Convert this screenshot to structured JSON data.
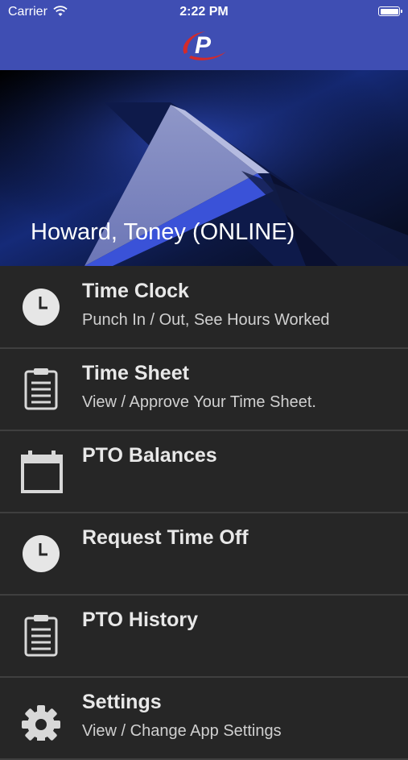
{
  "status_bar": {
    "carrier": "Carrier",
    "time": "2:22 PM"
  },
  "header": {
    "logo_icon": "company-p-logo"
  },
  "hero": {
    "user_label": "Howard, Toney (ONLINE)"
  },
  "menu": {
    "items": [
      {
        "title": "Time Clock",
        "subtitle": "Punch In / Out, See Hours Worked",
        "icon": "clock-icon"
      },
      {
        "title": "Time Sheet",
        "subtitle": "View / Approve Your Time Sheet.",
        "icon": "clipboard-icon"
      },
      {
        "title": "PTO Balances",
        "subtitle": "",
        "icon": "calendar-icon"
      },
      {
        "title": "Request Time Off",
        "subtitle": "",
        "icon": "clock-icon"
      },
      {
        "title": "PTO History",
        "subtitle": "",
        "icon": "clipboard-icon"
      },
      {
        "title": "Settings",
        "subtitle": "View / Change App Settings",
        "icon": "gear-icon"
      }
    ]
  },
  "colors": {
    "header_bg": "#3f4eb3",
    "menu_bg": "#262626",
    "logo_red": "#d42a2a"
  }
}
